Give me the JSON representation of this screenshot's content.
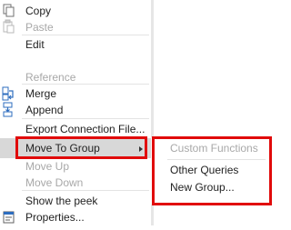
{
  "context_menu": {
    "items": [
      {
        "label": "Copy"
      },
      {
        "label": "Paste"
      },
      {
        "label": "Edit"
      },
      {
        "label": "Reference"
      },
      {
        "label": "Merge"
      },
      {
        "label": "Append"
      },
      {
        "label": "Export Connection File..."
      },
      {
        "label": "Move To Group"
      },
      {
        "label": "Move Up"
      },
      {
        "label": "Move Down"
      },
      {
        "label": "Show the peek"
      },
      {
        "label": "Properties..."
      }
    ]
  },
  "submenu": {
    "items": [
      {
        "label": "Custom Functions"
      },
      {
        "label": "Other Queries"
      },
      {
        "label": "New Group..."
      }
    ]
  },
  "colors": {
    "highlight_box": "#e10b0b",
    "selected_background": "#d8d8d8",
    "disabled_text": "#a8a8a8",
    "icon_blue": "#2d6dbf"
  }
}
